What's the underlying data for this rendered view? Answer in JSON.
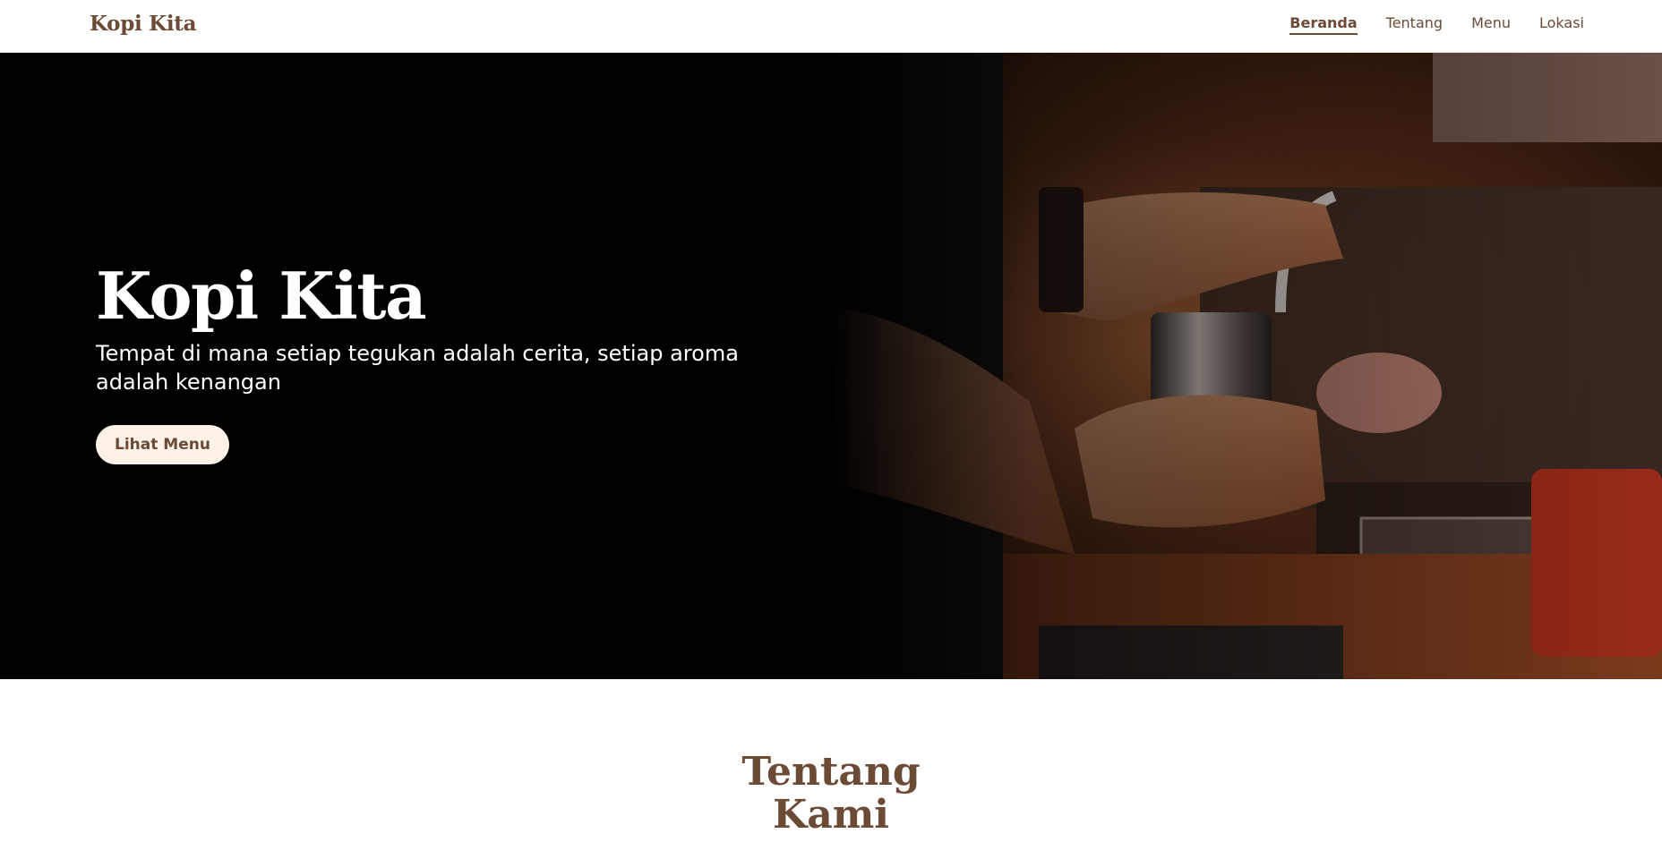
{
  "nav": {
    "brand": "Kopi Kita",
    "links": [
      {
        "label": "Beranda",
        "active": true
      },
      {
        "label": "Tentang",
        "active": false
      },
      {
        "label": "Menu",
        "active": false
      },
      {
        "label": "Lokasi",
        "active": false
      }
    ]
  },
  "hero": {
    "title": "Kopi Kita",
    "tagline": "Tempat di mana setiap tegukan adalah cerita, setiap aroma adalah kenangan",
    "cta_label": "Lihat Menu",
    "image_subject": "barista-preparing-espresso-photo"
  },
  "about": {
    "title": "Tentang Kami"
  },
  "colors": {
    "brand_brown": "#6b4a36",
    "cta_background": "#fbf1e6",
    "hero_background": "#000000"
  }
}
